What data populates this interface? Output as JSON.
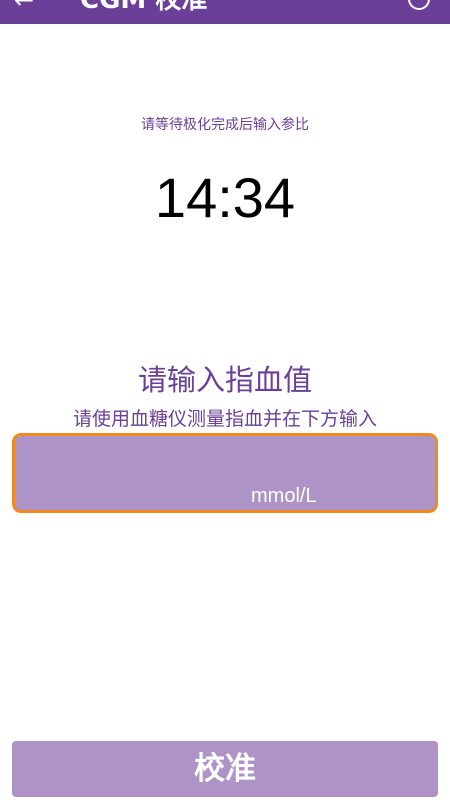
{
  "header": {
    "back_icon": "←",
    "title": "CGM 校准",
    "help_icon": "help-icon"
  },
  "polarization": {
    "instruction": "请等待极化完成后输入参比",
    "countdown": "14:34"
  },
  "fingerstick": {
    "heading": "请输入指血值",
    "hint": "请使用血糖仪测量指血并在下方输入",
    "value": "",
    "unit": "mmol/L"
  },
  "actions": {
    "calibrate_label": "校准"
  },
  "colors": {
    "brand_purple": "#6b3f98",
    "disabled_purple": "#ae94c6",
    "focus_orange": "#f08a1e"
  }
}
